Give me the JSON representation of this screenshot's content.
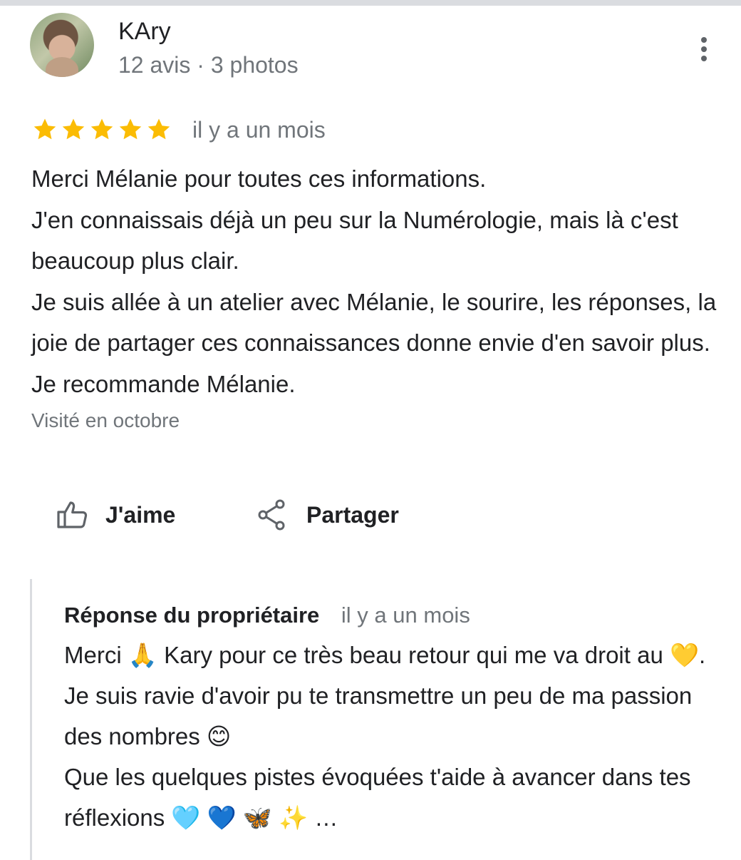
{
  "author": {
    "name": "KAry",
    "meta": "12 avis · 3 photos"
  },
  "review": {
    "rating": 5,
    "rating_max": 5,
    "time_ago": "il y a un mois",
    "lines": [
      "Merci Mélanie pour toutes ces informations.",
      "J'en connaissais déjà un peu sur la Numérologie, mais là c'est beaucoup plus clair.",
      "Je suis allée à un atelier avec Mélanie, le sourire, les réponses, la joie de partager ces connaissances donne envie d'en savoir plus. Je recommande Mélanie."
    ],
    "visited": "Visité en octobre"
  },
  "actions": {
    "like_label": "J'aime",
    "share_label": "Partager"
  },
  "owner_response": {
    "title": "Réponse du propriétaire",
    "time_ago": "il y a un mois",
    "lines": [
      "Merci 🙏 Kary pour ce très beau retour qui me va droit au 💛. Je suis ravie d'avoir pu te transmettre un peu de ma passion des nombres 😊",
      "Que les quelques pistes évoquées t'aide à avancer dans tes réflexions 🩵 💙 🦋 ✨ …"
    ]
  },
  "colors": {
    "star": "#fbbc04",
    "text": "#202124",
    "secondary_text": "#70757a",
    "icon": "#5f6368",
    "border": "#dadce0"
  },
  "icons": {
    "more": "more-vertical-icon",
    "like": "thumb-up-icon",
    "share": "share-icon",
    "star": "star-icon"
  }
}
